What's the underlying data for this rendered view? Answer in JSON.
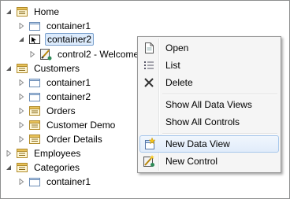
{
  "tree": {
    "nodes": [
      {
        "label": "Home",
        "icon": "page-icon",
        "expander": "expanded"
      },
      {
        "label": "container1",
        "icon": "container-icon",
        "expander": "collapsed"
      },
      {
        "label": "container2",
        "icon": "container-selected-icon",
        "expander": "expanded"
      },
      {
        "label": "control2 - Welcome",
        "icon": "control-icon",
        "expander": "collapsed"
      },
      {
        "label": "Customers",
        "icon": "page-icon",
        "expander": "expanded"
      },
      {
        "label": "container1",
        "icon": "container-icon",
        "expander": "collapsed"
      },
      {
        "label": "container2",
        "icon": "container-icon",
        "expander": "collapsed"
      },
      {
        "label": "Orders",
        "icon": "page-icon",
        "expander": "collapsed"
      },
      {
        "label": "Customer Demo",
        "icon": "page-icon",
        "expander": "collapsed"
      },
      {
        "label": "Order Details",
        "icon": "page-icon",
        "expander": "collapsed"
      },
      {
        "label": "Employees",
        "icon": "page-icon",
        "expander": "collapsed"
      },
      {
        "label": "Categories",
        "icon": "page-icon",
        "expander": "expanded"
      },
      {
        "label": "container1",
        "icon": "container-icon",
        "expander": "collapsed"
      }
    ]
  },
  "context_menu": {
    "items": [
      {
        "label": "Open",
        "icon": "document-icon"
      },
      {
        "label": "List",
        "icon": "list-icon"
      },
      {
        "label": "Delete",
        "icon": "delete-x-icon"
      },
      {
        "label": "Show All Data Views",
        "icon": ""
      },
      {
        "label": "Show All Controls",
        "icon": ""
      },
      {
        "label": "New Data View",
        "icon": "new-data-view-icon",
        "highlighted": true
      },
      {
        "label": "New Control",
        "icon": "new-control-icon"
      }
    ]
  },
  "colors": {
    "selection_bg": "#dcebfc",
    "selection_border": "#7da2ce",
    "menu_highlight_border": "#a8c8ec"
  }
}
